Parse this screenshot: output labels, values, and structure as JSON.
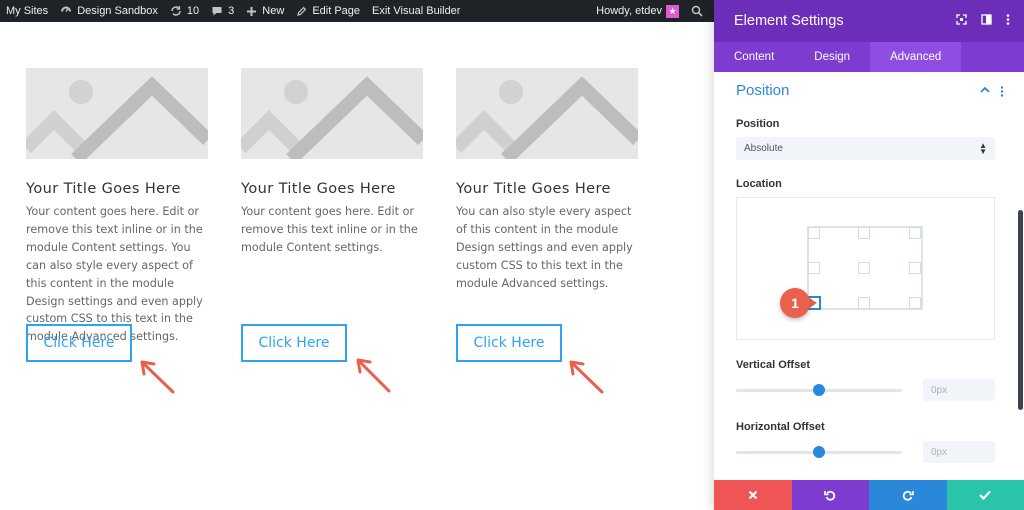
{
  "adminbar": {
    "my_sites": "My Sites",
    "site_name": "Design Sandbox",
    "updates_count": "10",
    "comments_count": "3",
    "new_label": "New",
    "edit_page": "Edit Page",
    "exit_builder": "Exit Visual Builder",
    "howdy": "Howdy, etdev"
  },
  "cards": [
    {
      "title": "Your Title Goes Here",
      "text": "Your content goes here. Edit or remove this text inline or in the module Content settings. You can also style every aspect of this content in the module Design settings and even apply custom CSS to this text in the module Advanced settings.",
      "button": "Click Here"
    },
    {
      "title": "Your Title Goes Here",
      "text": "Your content goes here. Edit or remove this text inline or in the module Content settings.",
      "button": "Click Here"
    },
    {
      "title": "Your Title Goes Here",
      "text": "You can also style every aspect of this content in the module Design settings and even apply custom CSS to this text in the module Advanced settings.",
      "button": "Click Here"
    }
  ],
  "panel": {
    "title": "Element Settings",
    "tabs": [
      "Content",
      "Design",
      "Advanced"
    ],
    "active_tab": "Advanced",
    "section_title": "Position",
    "position_label": "Position",
    "position_value": "Absolute",
    "location_label": "Location",
    "badge_number": "1",
    "vertical_offset_label": "Vertical Offset",
    "vertical_offset_value": "0px",
    "horizontal_offset_label": "Horizontal Offset",
    "horizontal_offset_value": "0px"
  },
  "colors": {
    "accent": "#2b87da",
    "panel_header": "#6c2eb9",
    "tabs": "#7e3bd0",
    "button_blue": "#2ea3f2",
    "annotation": "#e9604d",
    "footer": [
      "#ef5555",
      "#7e3bd0",
      "#2b87da",
      "#29c4a9"
    ]
  },
  "icons": {
    "footer": [
      "close-icon",
      "undo-icon",
      "redo-icon",
      "check-icon"
    ]
  }
}
